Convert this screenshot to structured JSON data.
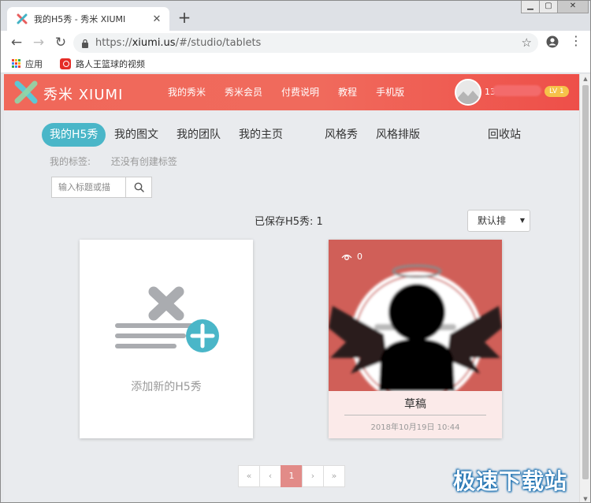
{
  "browser": {
    "tab_title": "我的H5秀 - 秀米 XIUMI",
    "new_tab": "+",
    "url_scheme": "https://",
    "url_host": "xiumi.us",
    "url_path": "/#/studio/tablets",
    "bookmarks": [
      {
        "label": "应用"
      },
      {
        "label": "路人王篮球的视频"
      }
    ]
  },
  "site": {
    "logo_text": "秀米 XIUMI",
    "nav": [
      "我的秀米",
      "秀米会员",
      "付费说明",
      "教程",
      "手机版"
    ],
    "username_prefix": "13",
    "level": "LV 1",
    "brand_color": "#f0685a",
    "accent_color": "#4ab6c8"
  },
  "studio": {
    "tabs": [
      {
        "label": "我的H5秀",
        "active": true
      },
      {
        "label": "我的图文"
      },
      {
        "label": "我的团队"
      },
      {
        "label": "我的主页"
      },
      {
        "label": "风格秀"
      },
      {
        "label": "风格排版"
      },
      {
        "label": "回收站"
      }
    ],
    "tags_label": "我的标签:",
    "tags_empty": "还没有创建标签",
    "search_placeholder": "输入标题或描",
    "saved_count": "已保存H5秀: 1",
    "sort_label": "默认排",
    "new_card_label": "添加新的H5秀",
    "draft": {
      "views": "0",
      "title": "草稿",
      "date": "2018年10月19日 10:44"
    },
    "pagination": [
      "«",
      "‹",
      "1",
      "›",
      "»"
    ],
    "current_page": "1"
  },
  "watermark": "极速下载站"
}
